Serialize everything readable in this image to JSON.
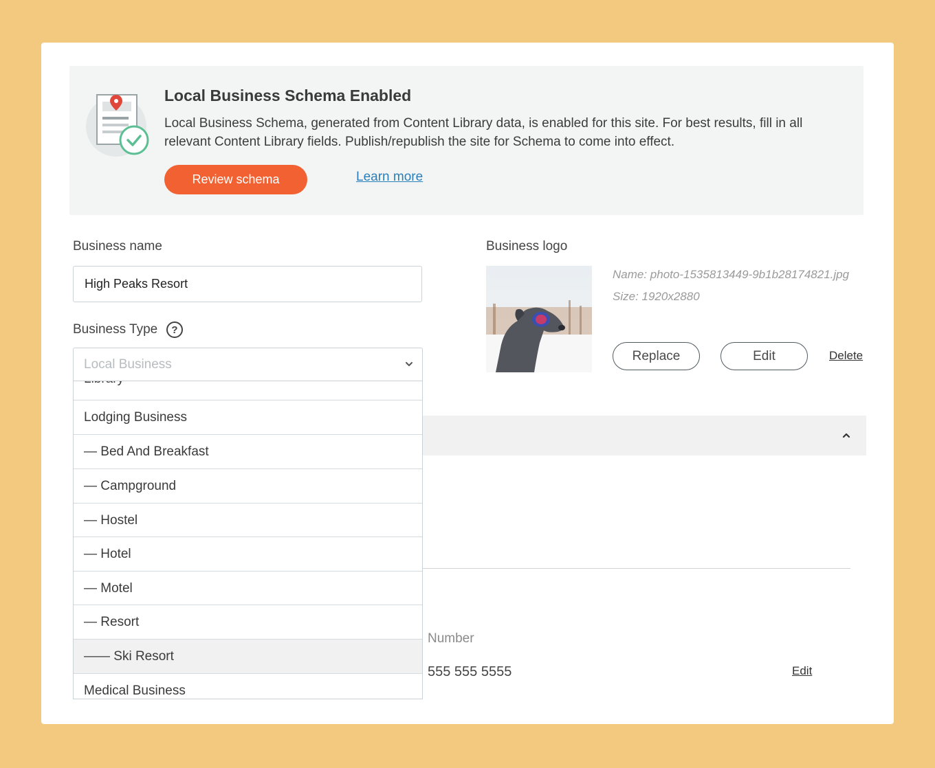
{
  "banner": {
    "title": "Local Business Schema Enabled",
    "description": "Local Business Schema, generated from Content Library data, is enabled for this site. For best results, fill in all relevant Content Library fields. Publish/republish the site for Schema to come into effect.",
    "review_label": "Review schema",
    "learn_more_label": "Learn more",
    "icon": "schema-document-check-icon"
  },
  "form": {
    "business_name_label": "Business name",
    "business_name_value": "High Peaks Resort",
    "business_type_label": "Business Type",
    "help_glyph": "?",
    "business_type_placeholder": "Local Business",
    "dropdown_items": [
      "Library",
      "Lodging Business",
      "— Bed And Breakfast",
      "— Campground",
      "— Hostel",
      "— Hotel",
      "— Motel",
      "— Resort",
      "—— Ski Resort",
      "Medical Business"
    ],
    "selected_item": "—— Ski Resort"
  },
  "logo": {
    "label": "Business logo",
    "name": "Name: photo-1535813449-9b1b28174821.jpg",
    "size": "Size: 1920x2880",
    "replace_label": "Replace",
    "edit_label": "Edit",
    "delete_label": "Delete"
  },
  "contact": {
    "number_label": "Number",
    "number_value": "555 555 5555",
    "edit_label": "Edit"
  },
  "colors": {
    "page_background": "#f3c97f",
    "accent": "#f26131",
    "link": "#2a7fba"
  }
}
